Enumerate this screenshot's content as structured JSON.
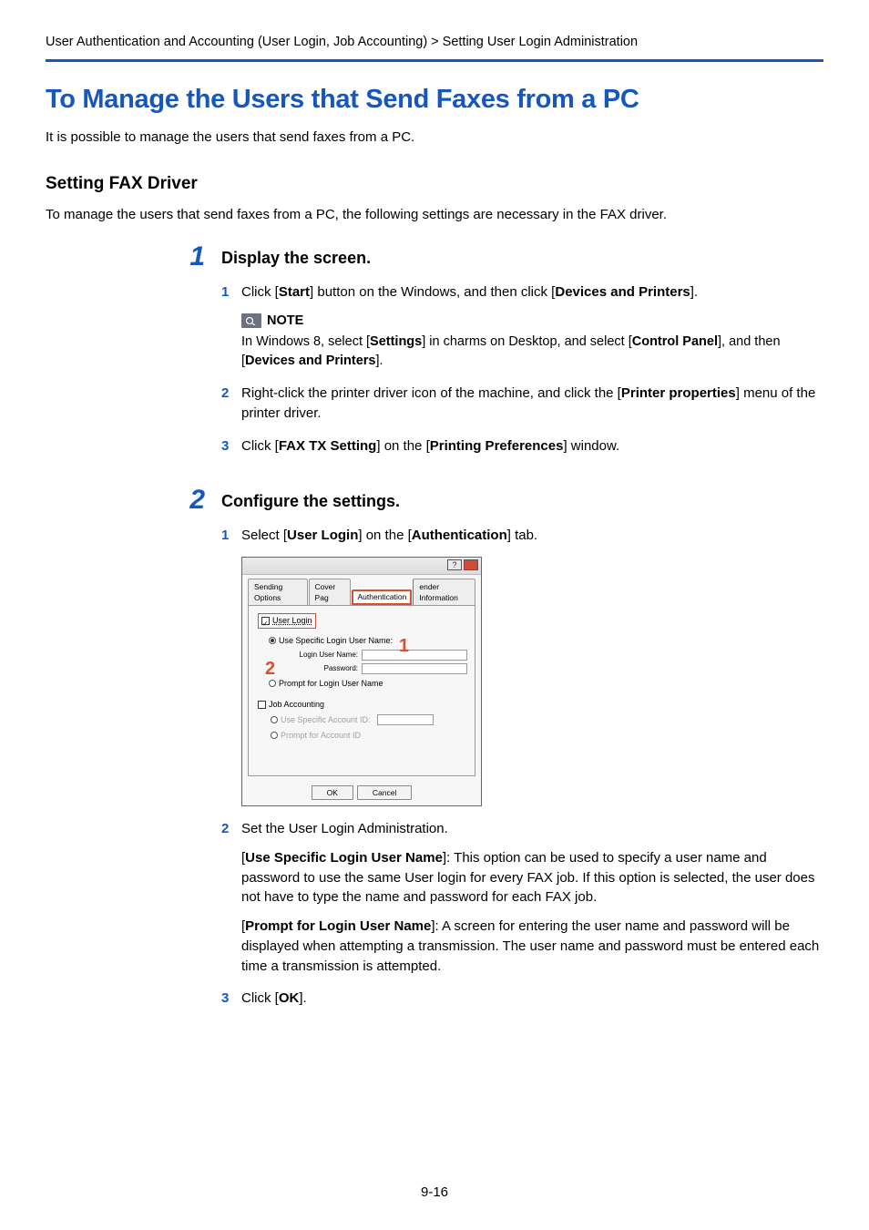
{
  "breadcrumb": "User Authentication and Accounting (User Login, Job Accounting) > Setting User Login Administration",
  "main_title": "To Manage the Users that Send Faxes from a PC",
  "intro": "It is possible to manage the users that send faxes from a PC.",
  "subsection_title": "Setting FAX Driver",
  "subintro": "To manage the users that send faxes from a PC, the following settings are necessary in the FAX driver.",
  "step1": {
    "num": "1",
    "title": "Display the screen.",
    "items": {
      "a_num": "1",
      "a_pre": "Click [",
      "a_b1": "Start",
      "a_mid": "] button on the Windows, and then click [",
      "a_b2": "Devices and Printers",
      "a_post": "].",
      "note_label": "NOTE",
      "note_pre": "In Windows 8, select [",
      "note_b1": "Settings",
      "note_mid1": "] in charms on Desktop, and select [",
      "note_b2": "Control Panel",
      "note_mid2": "], and then [",
      "note_b3": "Devices and Printers",
      "note_post": "].",
      "b_num": "2",
      "b_pre": "Right-click the printer driver icon of the machine, and click the [",
      "b_b1": "Printer properties",
      "b_post": "] menu of the printer driver.",
      "c_num": "3",
      "c_pre": "Click [",
      "c_b1": "FAX TX Setting",
      "c_mid": "] on the [",
      "c_b2": "Printing Preferences",
      "c_post": "] window."
    }
  },
  "step2": {
    "num": "2",
    "title": "Configure the settings.",
    "items": {
      "a_num": "1",
      "a_pre": "Select [",
      "a_b1": "User Login",
      "a_mid": "] on the [",
      "a_b2": "Authentication",
      "a_post": "] tab.",
      "b_num": "2",
      "b_text": "Set the User Login Administration.",
      "b_p1_pre": "[",
      "b_p1_b": "Use Specific Login User Name",
      "b_p1_post": "]: This option can be used to specify a user name and password to use the same User login for every FAX job. If this option is selected, the user does not have to type the name and password for each FAX job.",
      "b_p2_pre": "[",
      "b_p2_b": "Prompt for Login User Name",
      "b_p2_post": "]: A screen for entering the user name and password will be displayed when attempting a transmission. The user name and password must be entered each time a transmission is attempted.",
      "c_num": "3",
      "c_pre": "Click [",
      "c_b1": "OK",
      "c_post": "]."
    }
  },
  "dialog": {
    "tab1": "Sending Options",
    "tab2": "Cover Pag",
    "tab3": "Authentication",
    "tab4": "ender Information",
    "user_login": "User Login",
    "use_specific": "Use Specific Login User Name:",
    "login_user": "Login User Name:",
    "password": "Password:",
    "prompt_login": "Prompt for Login User Name",
    "job_acc": "Job Accounting",
    "use_acc": "Use Specific Account ID:",
    "prompt_acc": "Prompt for Account ID",
    "ok": "OK",
    "cancel": "Cancel",
    "callout1": "1",
    "callout2": "2"
  },
  "page_num": "9-16"
}
